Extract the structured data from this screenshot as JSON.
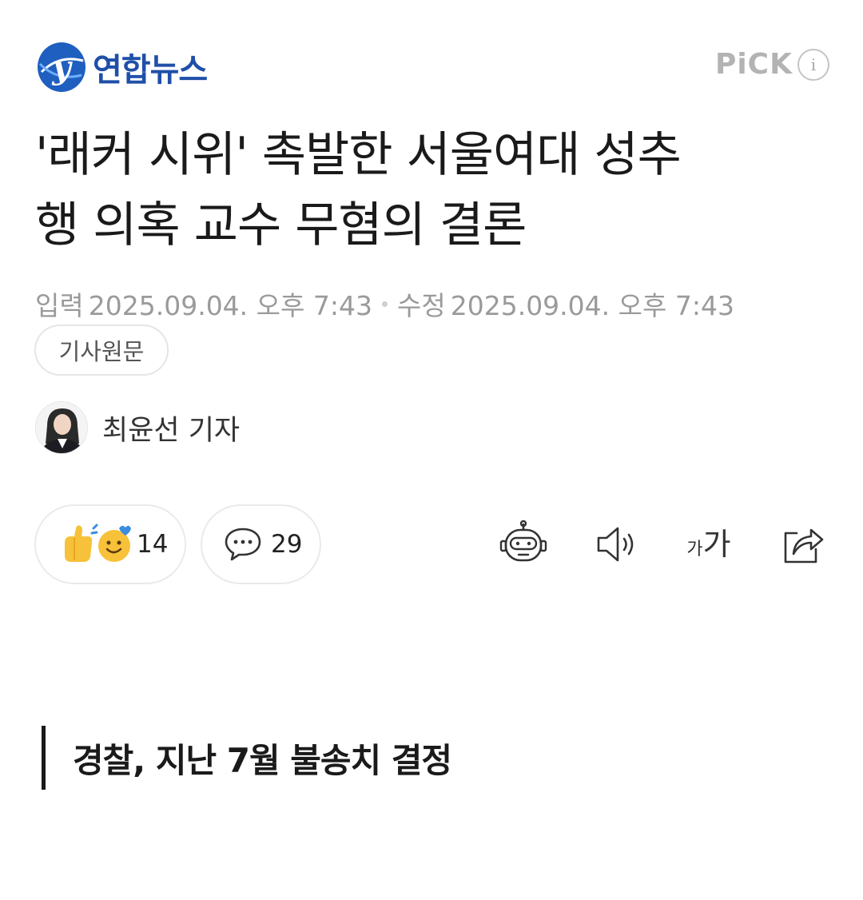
{
  "header": {
    "logo_text": "연합뉴스",
    "pick_label": "PiCK",
    "info_glyph": "i"
  },
  "article": {
    "headline_line1": "'래커 시위' 촉발한 서울여대 성추",
    "headline_line2": "행 의혹 교수 무혐의 결론",
    "input_label": "입력",
    "input_time": "2025.09.04. 오후 7:43",
    "modified_label": "수정",
    "modified_time": "2025.09.04. 오후 7:43",
    "original_button": "기사원문",
    "reporter": "최윤선 기자",
    "subheading": "경찰, 지난 7월 불송치 결정"
  },
  "actions": {
    "reaction_count": "14",
    "comment_count": "29",
    "font_size_small": "가",
    "font_size_large": "가"
  },
  "icons": {
    "logo": "yonhap-logo-icon",
    "info": "info-icon",
    "reaction": "emoji-reaction-icon",
    "comment": "comment-icon",
    "ai_summary": "robot-icon",
    "tts": "speaker-icon",
    "font_size": "font-size-icon",
    "share": "share-icon"
  },
  "colors": {
    "brand_blue": "#1f4fa8",
    "pick_gray": "#b3b3b3",
    "meta_gray": "#9a9a9a",
    "emoji_yellow": "#f7c13a"
  }
}
